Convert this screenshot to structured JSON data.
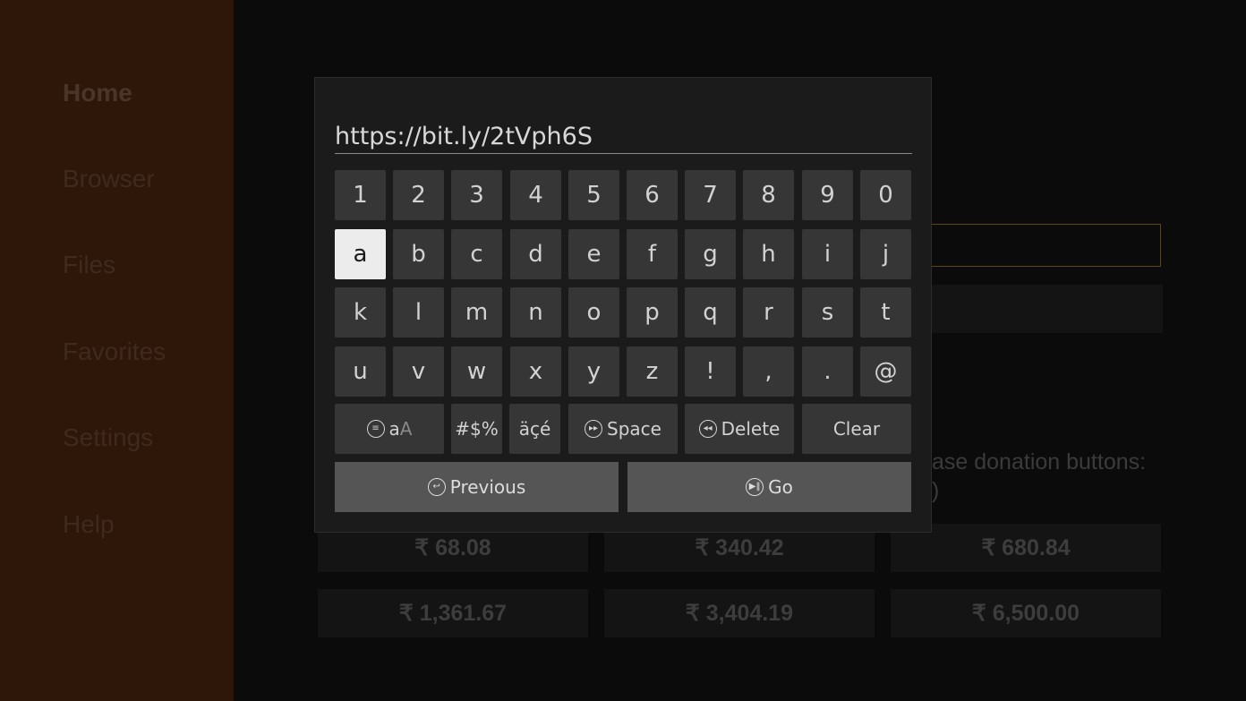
{
  "sidebar": {
    "items": [
      {
        "label": "Home"
      },
      {
        "label": "Browser"
      },
      {
        "label": "Files"
      },
      {
        "label": "Favorites"
      },
      {
        "label": "Settings"
      },
      {
        "label": "Help"
      }
    ],
    "active": "Home"
  },
  "background": {
    "note_line1": "ase donation buttons:",
    "note_line2": ")",
    "donations": [
      "₹ 68.08",
      "₹ 340.42",
      "₹ 680.84",
      "₹ 1,361.67",
      "₹ 3,404.19",
      "₹ 6,500.00"
    ]
  },
  "keyboard": {
    "input_value": "https://bit.ly/2tVph6S",
    "rows": [
      [
        "1",
        "2",
        "3",
        "4",
        "5",
        "6",
        "7",
        "8",
        "9",
        "0"
      ],
      [
        "a",
        "b",
        "c",
        "d",
        "e",
        "f",
        "g",
        "h",
        "i",
        "j"
      ],
      [
        "k",
        "l",
        "m",
        "n",
        "o",
        "p",
        "q",
        "r",
        "s",
        "t"
      ],
      [
        "u",
        "v",
        "w",
        "x",
        "y",
        "z",
        "!",
        ",",
        ".",
        "@"
      ]
    ],
    "selected_key": "a",
    "case_key": {
      "lower": "a",
      "upper": "A"
    },
    "symbols_label": "#$%",
    "accents_label": "äçé",
    "space_label": "Space",
    "delete_label": "Delete",
    "clear_label": "Clear",
    "previous_label": "Previous",
    "go_label": "Go"
  },
  "colors": {
    "sidebar_bg": "#2e1609",
    "key_bg": "#363636",
    "key_selected_bg": "#ececec",
    "action_bg": "#555555"
  }
}
